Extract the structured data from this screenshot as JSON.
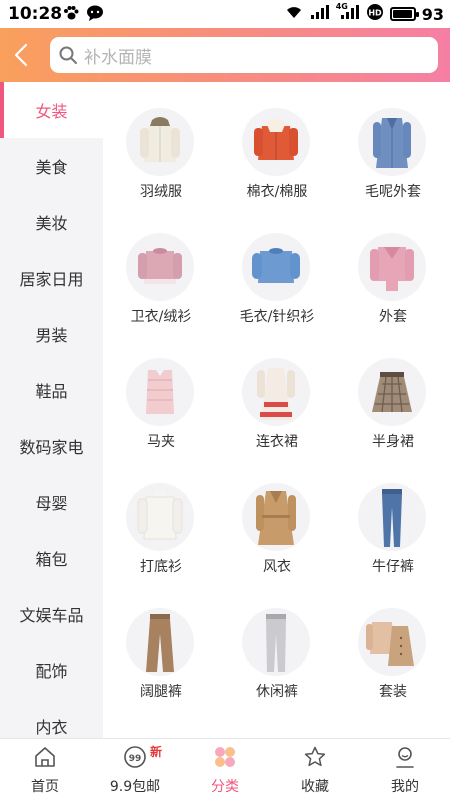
{
  "status_bar": {
    "time": "10:28",
    "battery": "93",
    "battery_level": 0.93,
    "network": "4G"
  },
  "search": {
    "placeholder": "补水面膜"
  },
  "sidebar": {
    "active_index": 0,
    "items": [
      "女装",
      "美食",
      "美妆",
      "居家日用",
      "男装",
      "鞋品",
      "数码家电",
      "母婴",
      "箱包",
      "文娱车品",
      "配饰",
      "内衣"
    ]
  },
  "categories": [
    {
      "label": "羽绒服",
      "icon": "down-jacket-icon"
    },
    {
      "label": "棉衣/棉服",
      "icon": "cotton-jacket-icon"
    },
    {
      "label": "毛呢外套",
      "icon": "wool-coat-icon"
    },
    {
      "label": "卫衣/绒衫",
      "icon": "hoodie-icon"
    },
    {
      "label": "毛衣/针织衫",
      "icon": "sweater-icon"
    },
    {
      "label": "外套",
      "icon": "jacket-icon"
    },
    {
      "label": "马夹",
      "icon": "vest-icon"
    },
    {
      "label": "连衣裙",
      "icon": "dress-icon"
    },
    {
      "label": "半身裙",
      "icon": "skirt-icon"
    },
    {
      "label": "打底衫",
      "icon": "base-shirt-icon"
    },
    {
      "label": "风衣",
      "icon": "trench-coat-icon"
    },
    {
      "label": "牛仔裤",
      "icon": "jeans-icon"
    },
    {
      "label": "阔腿裤",
      "icon": "wide-pants-icon"
    },
    {
      "label": "休闲裤",
      "icon": "casual-pants-icon"
    },
    {
      "label": "套装",
      "icon": "suit-set-icon"
    }
  ],
  "bottom_nav": {
    "active_index": 2,
    "new_badge": "新",
    "items": [
      {
        "label": "首页",
        "icon": "home-icon"
      },
      {
        "label": "9.9包邮",
        "icon": "nine-nine-icon"
      },
      {
        "label": "分类",
        "icon": "category-icon"
      },
      {
        "label": "收藏",
        "icon": "star-icon"
      },
      {
        "label": "我的",
        "icon": "user-icon"
      }
    ]
  },
  "colors": {
    "accent": "#f0577e",
    "header_start": "#f9a05c",
    "header_end": "#f57fa4",
    "sidebar_bg": "#f4f4f6"
  }
}
